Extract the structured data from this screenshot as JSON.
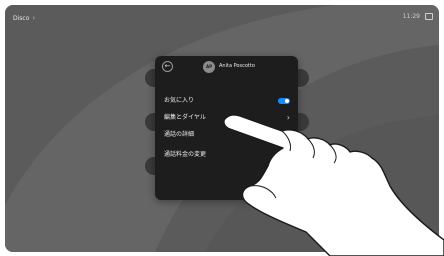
{
  "topbar": {
    "location": "Disco",
    "location_chevron": "›",
    "time": "11:29",
    "keyboard_icon": "keyboard-icon"
  },
  "panel": {
    "back_glyph": "←",
    "avatar_initials": "AP",
    "contact_name": "Anita Poscotto",
    "items": [
      {
        "label": "お気に入り",
        "control": "toggle",
        "state": "on"
      },
      {
        "label": "編集とダイヤル",
        "control": "chevron",
        "glyph": "›"
      },
      {
        "label": "通話の詳細",
        "control": "chevron",
        "glyph": "›"
      },
      {
        "label": "通話料金の変更",
        "control": "none"
      }
    ]
  },
  "colors": {
    "screen_bg": "#5e5e5e",
    "panel_bg": "#1d1d1d",
    "toggle_on": "#1a8cff"
  }
}
